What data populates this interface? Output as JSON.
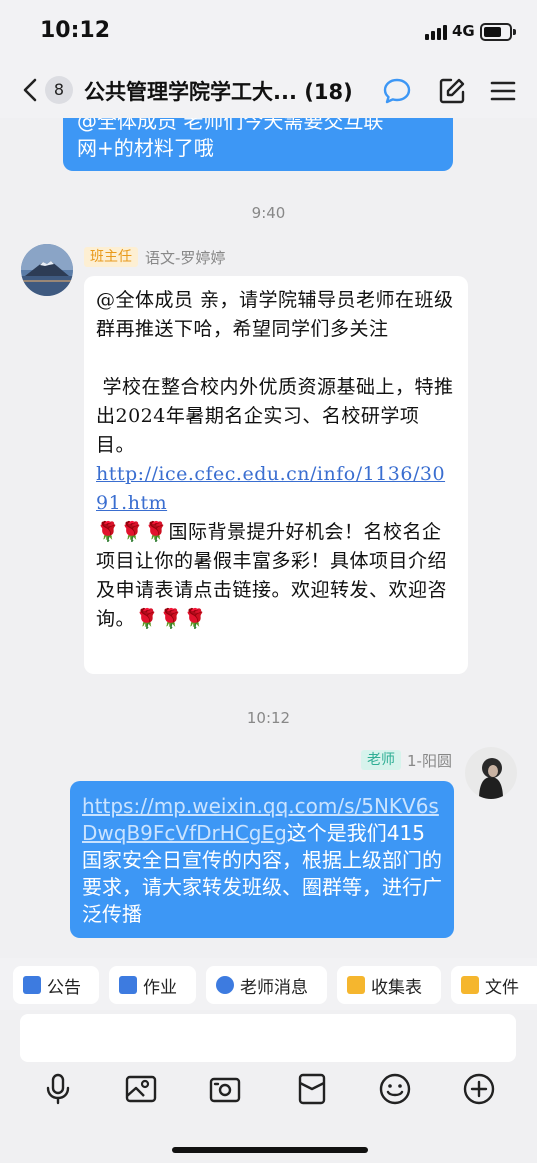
{
  "status": {
    "time": "10:12",
    "network": "4G"
  },
  "header": {
    "unread_count": "8",
    "title": "公共管理学院学工大... (18)"
  },
  "messages": {
    "prev_bubble_text": "@全体成员 老师们今天需要交互联\n网+的材料了哦",
    "time1": "9:40",
    "msg1": {
      "role": "班主任",
      "sender": "语文-罗婷婷",
      "p1": "@全体成员 亲，请学院辅导员老师在班级群再推送下哈，希望同学们多关注",
      "p2": " 学校在整合校内外优质资源基础上，特推出2024年暑期名企实习、名校研学项目。",
      "link": "http://ice.cfec.edu.cn/info/1136/3091.htm",
      "roses_a": "🌹🌹🌹",
      "p3": "国际背景提升好机会！名校名企项目让你的暑假丰富多彩！具体项目介绍及申请表请点击链接。欢迎转发、欢迎咨询。",
      "roses_b": "🌹🌹🌹"
    },
    "time2": "10:12",
    "msg2": {
      "role": "老师",
      "sender": "1-阳圆",
      "link": "https://mp.weixin.qq.com/s/5NKV6sDwqB9FcVfDrHCgEg",
      "text": "这个是我们415国家安全日宣传的内容，根据上级部门的要求，请大家转发班级、圈群等，进行广泛传播"
    }
  },
  "quickbar": {
    "announcement": "公告",
    "homework": "作业",
    "teacher_msg": "老师消息",
    "collect_form": "收集表",
    "files": "文件"
  },
  "colors": {
    "accent": "#3d97f5",
    "role_head": "#f5a623",
    "role_teacher": "#3bbfa6"
  }
}
